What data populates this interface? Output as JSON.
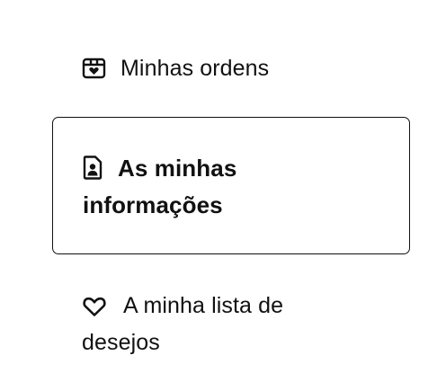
{
  "menu": {
    "items": [
      {
        "label": "Minhas ordens",
        "icon": "gift-box-heart-icon",
        "active": false
      },
      {
        "label": "As minhas informações",
        "icon": "user-document-icon",
        "active": true
      },
      {
        "label": "A minha lista de desejos",
        "icon": "heart-icon",
        "active": false
      }
    ]
  },
  "colors": {
    "text": "#111111",
    "border": "#111111",
    "background": "#ffffff"
  }
}
